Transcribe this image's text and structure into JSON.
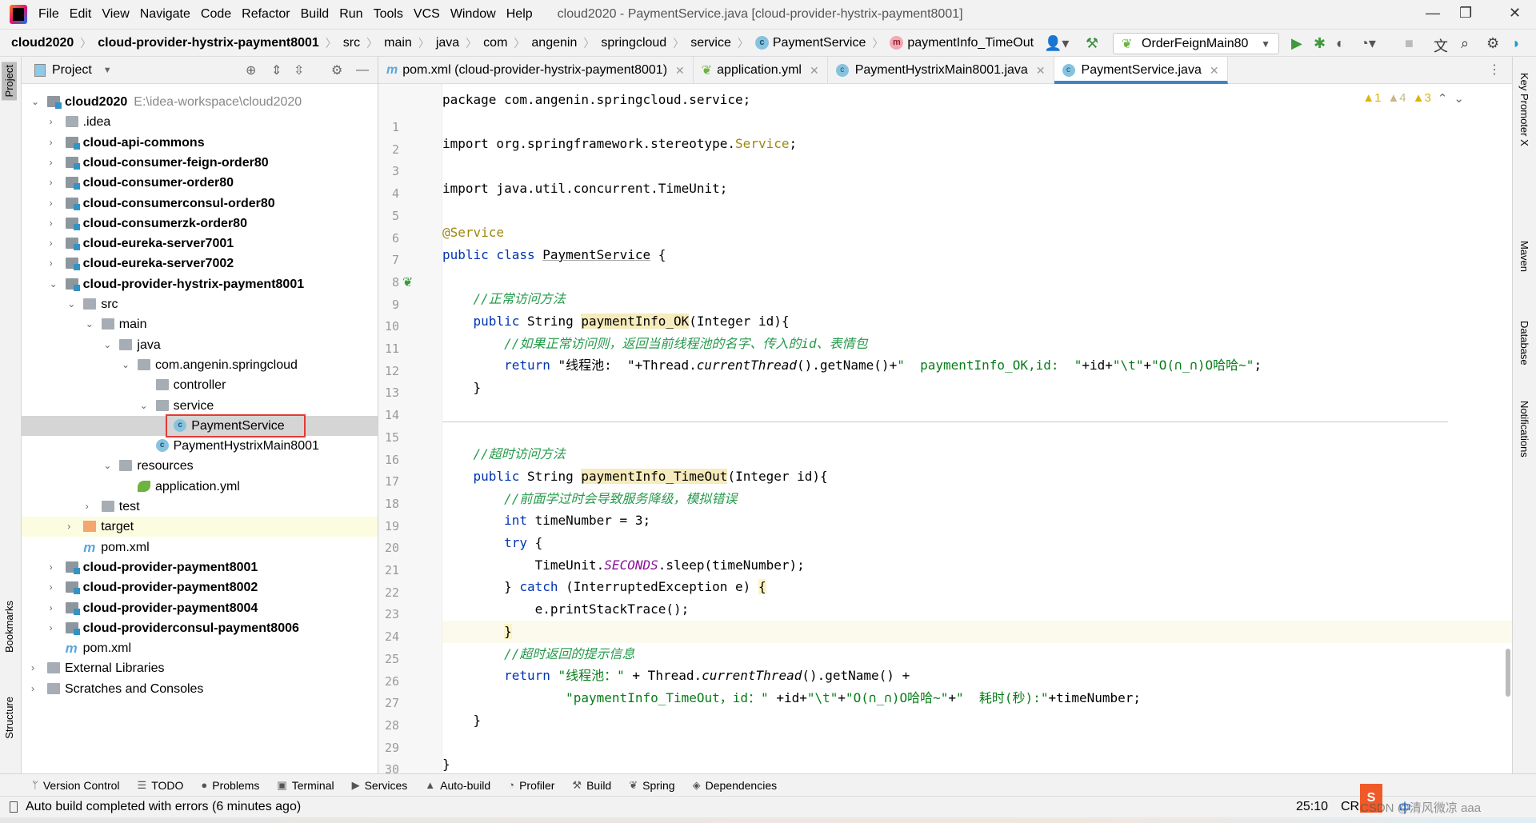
{
  "menu": [
    "File",
    "Edit",
    "View",
    "Navigate",
    "Code",
    "Refactor",
    "Build",
    "Run",
    "Tools",
    "VCS",
    "Window",
    "Help"
  ],
  "window_title": "cloud2020 - PaymentService.java [cloud-provider-hystrix-payment8001]",
  "breadcrumbs": [
    "cloud2020",
    "cloud-provider-hystrix-payment8001",
    "src",
    "main",
    "java",
    "com",
    "angenin",
    "springcloud",
    "service",
    "PaymentService",
    "paymentInfo_TimeOut"
  ],
  "run_config": "OrderFeignMain80",
  "project_panel": {
    "title": "Project"
  },
  "tree": [
    {
      "level": 0,
      "arrow": "open",
      "icon": "module",
      "label": "cloud2020",
      "bold": true,
      "extra": "E:\\idea-workspace\\cloud2020"
    },
    {
      "level": 1,
      "arrow": "closed",
      "icon": "folder",
      "label": ".idea"
    },
    {
      "level": 1,
      "arrow": "closed",
      "icon": "module",
      "label": "cloud-api-commons",
      "bold": true
    },
    {
      "level": 1,
      "arrow": "closed",
      "icon": "module",
      "label": "cloud-consumer-feign-order80",
      "bold": true
    },
    {
      "level": 1,
      "arrow": "closed",
      "icon": "module",
      "label": "cloud-consumer-order80",
      "bold": true
    },
    {
      "level": 1,
      "arrow": "closed",
      "icon": "module",
      "label": "cloud-consumerconsul-order80",
      "bold": true
    },
    {
      "level": 1,
      "arrow": "closed",
      "icon": "module",
      "label": "cloud-consumerzk-order80",
      "bold": true
    },
    {
      "level": 1,
      "arrow": "closed",
      "icon": "module",
      "label": "cloud-eureka-server7001",
      "bold": true
    },
    {
      "level": 1,
      "arrow": "closed",
      "icon": "module",
      "label": "cloud-eureka-server7002",
      "bold": true
    },
    {
      "level": 1,
      "arrow": "open",
      "icon": "module",
      "label": "cloud-provider-hystrix-payment8001",
      "bold": true
    },
    {
      "level": 2,
      "arrow": "open",
      "icon": "folder",
      "label": "src"
    },
    {
      "level": 3,
      "arrow": "open",
      "icon": "folder",
      "label": "main"
    },
    {
      "level": 4,
      "arrow": "open",
      "icon": "folder",
      "label": "java"
    },
    {
      "level": 5,
      "arrow": "open",
      "icon": "package",
      "label": "com.angenin.springcloud"
    },
    {
      "level": 6,
      "arrow": "",
      "icon": "package",
      "label": "controller"
    },
    {
      "level": 6,
      "arrow": "open",
      "icon": "package",
      "label": "service"
    },
    {
      "level": 7,
      "arrow": "",
      "icon": "class",
      "label": "PaymentService",
      "selected": true
    },
    {
      "level": 6,
      "arrow": "",
      "icon": "class-main",
      "label": "PaymentHystrixMain8001"
    },
    {
      "level": 4,
      "arrow": "open",
      "icon": "resources",
      "label": "resources"
    },
    {
      "level": 5,
      "arrow": "",
      "icon": "spring-yml",
      "label": "application.yml"
    },
    {
      "level": 3,
      "arrow": "closed",
      "icon": "folder",
      "label": "test"
    },
    {
      "level": 2,
      "arrow": "closed",
      "icon": "target",
      "label": "target",
      "highlight": true
    },
    {
      "level": 2,
      "arrow": "",
      "icon": "maven",
      "label": "pom.xml"
    },
    {
      "level": 1,
      "arrow": "closed",
      "icon": "module",
      "label": "cloud-provider-payment8001",
      "bold": true
    },
    {
      "level": 1,
      "arrow": "closed",
      "icon": "module",
      "label": "cloud-provider-payment8002",
      "bold": true
    },
    {
      "level": 1,
      "arrow": "closed",
      "icon": "module",
      "label": "cloud-provider-payment8004",
      "bold": true
    },
    {
      "level": 1,
      "arrow": "closed",
      "icon": "module",
      "label": "cloud-providerconsul-payment8006",
      "bold": true
    },
    {
      "level": 1,
      "arrow": "",
      "icon": "maven",
      "label": "pom.xml"
    },
    {
      "level": 0,
      "arrow": "closed",
      "icon": "libraries",
      "label": "External Libraries"
    },
    {
      "level": 0,
      "arrow": "closed",
      "icon": "scratches",
      "label": "Scratches and Consoles"
    }
  ],
  "tabs": [
    {
      "label": "pom.xml (cloud-provider-hystrix-payment8001)",
      "icon": "maven"
    },
    {
      "label": "application.yml",
      "icon": "spring-yml"
    },
    {
      "label": "PaymentHystrixMain8001.java",
      "icon": "class-main"
    },
    {
      "label": "PaymentService.java",
      "icon": "class",
      "active": true
    }
  ],
  "inspections": {
    "errors": "1",
    "warnings": "4",
    "weak": "3"
  },
  "current_line": 25,
  "code": [
    [
      [
        "package com.angenin.springcloud.service;",
        ""
      ]
    ],
    [],
    [
      [
        "import org.springframework.stereotype.",
        "kw0"
      ],
      [
        "Service",
        "an"
      ],
      [
        ";",
        ""
      ]
    ],
    [],
    [
      [
        "import java.util.concurrent.TimeUnit;",
        ""
      ]
    ],
    [],
    [
      [
        "@Service",
        "an"
      ]
    ],
    [
      [
        "public class ",
        "kw"
      ],
      [
        "PaymentService",
        "und"
      ],
      [
        " {",
        ""
      ]
    ],
    [],
    [
      [
        "    //正常访问方法",
        "cm"
      ]
    ],
    [
      [
        "    public ",
        "kw"
      ],
      [
        "String ",
        ""
      ],
      [
        "paymentInfo_OK",
        "hl"
      ],
      [
        "(Integer id){",
        ""
      ]
    ],
    [
      [
        "        //如果正常访问则，返回当前线程池的名字、传入的id、表情包",
        "cm"
      ]
    ],
    [
      [
        "        return ",
        "kw"
      ],
      [
        "\"线程池:  \"",
        ""
      ],
      [
        "+Thread.",
        ""
      ],
      [
        "currentThread",
        "it"
      ],
      [
        "().getName()+",
        ""
      ],
      [
        "\"  paymentInfo_OK,id:  \"",
        "str"
      ],
      [
        "+id+",
        ""
      ],
      [
        "\"\\t\"",
        "str"
      ],
      [
        "+",
        ""
      ],
      [
        "\"O(∩_∩)O哈哈~\"",
        "str"
      ],
      [
        ";",
        ""
      ]
    ],
    [
      [
        "    }",
        ""
      ]
    ],
    [],
    [],
    [
      [
        "    //超时访问方法",
        "cm"
      ]
    ],
    [
      [
        "    public ",
        "kw"
      ],
      [
        "String ",
        ""
      ],
      [
        "paymentInfo_TimeOut",
        "hl"
      ],
      [
        "(Integer id){",
        ""
      ]
    ],
    [
      [
        "        //前面学过时会导致服务降级，模拟错误",
        "cm"
      ]
    ],
    [
      [
        "        int ",
        "kw"
      ],
      [
        "timeNumber = ",
        ""
      ],
      [
        "3",
        "kw0"
      ],
      [
        ";",
        ""
      ]
    ],
    [
      [
        "        try ",
        "kw"
      ],
      [
        "{",
        ""
      ]
    ],
    [
      [
        "            TimeUnit.",
        ""
      ],
      [
        "SECONDS",
        "st"
      ],
      [
        ".sleep(timeNumber);",
        ""
      ]
    ],
    [
      [
        "        } ",
        ""
      ],
      [
        "catch ",
        "kw"
      ],
      [
        "(InterruptedException e) ",
        ""
      ],
      [
        "{",
        "br"
      ]
    ],
    [
      [
        "            e.printStackTrace();",
        ""
      ]
    ],
    [
      [
        "        ",
        ""
      ],
      [
        "}",
        "br"
      ]
    ],
    [
      [
        "        //超时返回的提示信息",
        "cm"
      ]
    ],
    [
      [
        "        return ",
        "kw"
      ],
      [
        "\"线程池：\"",
        "str"
      ],
      [
        " + Thread.",
        ""
      ],
      [
        "currentThread",
        "it"
      ],
      [
        "().getName() +",
        ""
      ]
    ],
    [
      [
        "                ",
        ""
      ],
      [
        "\"paymentInfo_TimeOut，id：\"",
        "str"
      ],
      [
        " +id+",
        ""
      ],
      [
        "\"\\t\"",
        "str"
      ],
      [
        "+",
        ""
      ],
      [
        "\"O(∩_∩)O哈哈~\"",
        "str"
      ],
      [
        "+",
        ""
      ],
      [
        "\"  耗时(秒):\"",
        "str"
      ],
      [
        "+timeNumber;",
        ""
      ]
    ],
    [
      [
        "    }",
        ""
      ]
    ],
    [],
    [
      [
        "}",
        ""
      ]
    ]
  ],
  "left_strip": [
    "Project",
    "Bookmarks",
    "Structure"
  ],
  "right_strip": [
    "Key Promoter X",
    "Maven",
    "Database",
    "Notifications"
  ],
  "tool_windows": [
    {
      "label": "Version Control",
      "icon": "branch-icon"
    },
    {
      "label": "TODO",
      "icon": "list-icon"
    },
    {
      "label": "Problems",
      "icon": "problems-icon"
    },
    {
      "label": "Terminal",
      "icon": "terminal-icon"
    },
    {
      "label": "Services",
      "icon": "services-icon"
    },
    {
      "label": "Auto-build",
      "icon": "warning-icon"
    },
    {
      "label": "Profiler",
      "icon": "profiler-icon"
    },
    {
      "label": "Build",
      "icon": "hammer-icon"
    },
    {
      "label": "Spring",
      "icon": "spring-icon"
    },
    {
      "label": "Dependencies",
      "icon": "dependencies-icon"
    }
  ],
  "status": {
    "message": "Auto build completed with errors (6 minutes ago)",
    "position": "25:10",
    "line_sep": "CRLF",
    "ime": "中",
    "watermark": "CSDN @清风微凉 aaa"
  },
  "colors": {
    "accent": "#4083c9",
    "selection": "#d5d5d5",
    "red_box": "#e53935",
    "current_line": "#fcfaed"
  }
}
